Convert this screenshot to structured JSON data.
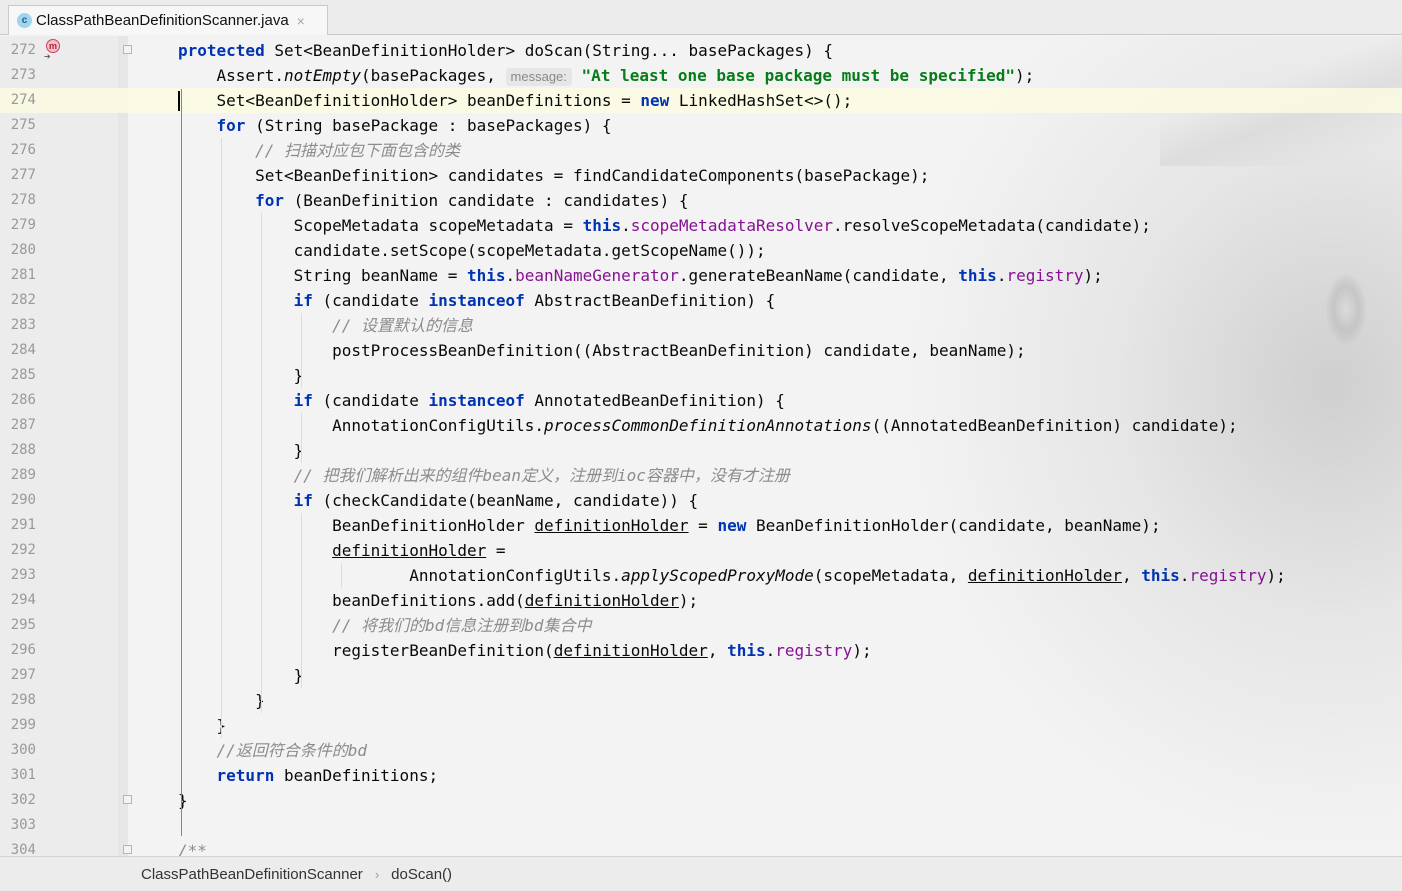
{
  "tab": {
    "icon_letter": "c",
    "title": "ClassPathBeanDefinitionScanner.java",
    "close": "×"
  },
  "gutter_icon": {
    "method_letter": "m"
  },
  "lines": [
    {
      "num": "272",
      "code": "<span class='kw'>protected</span> Set&lt;BeanDefinitionHolder&gt; doScan(String... basePackages) {"
    },
    {
      "num": "273",
      "code": "    Assert.<span class='it'>notEmpty</span>(basePackages, <span class='hint'>message:</span> <span class='str'>\"At least one base package must be specified\"</span>);"
    },
    {
      "num": "274",
      "code": "    Set&lt;BeanDefinitionHolder&gt; beanDefinitions = <span class='kw'>new</span> LinkedHashSet&lt;&gt;();"
    },
    {
      "num": "275",
      "code": "    <span class='kw'>for</span> (String basePackage : basePackages) {"
    },
    {
      "num": "276",
      "code": "        <span class='cmt'>// 扫描对应包下面包含的类</span>"
    },
    {
      "num": "277",
      "code": "        Set&lt;BeanDefinition&gt; candidates = findCandidateComponents(basePackage);"
    },
    {
      "num": "278",
      "code": "        <span class='kw'>for</span> (BeanDefinition candidate : candidates) {"
    },
    {
      "num": "279",
      "code": "            ScopeMetadata scopeMetadata = <span class='kw'>this</span>.<span class='fld'>scopeMetadataResolver</span>.resolveScopeMetadata(candidate);"
    },
    {
      "num": "280",
      "code": "            candidate.setScope(scopeMetadata.getScopeName());"
    },
    {
      "num": "281",
      "code": "            String beanName = <span class='kw'>this</span>.<span class='fld'>beanNameGenerator</span>.generateBeanName(candidate, <span class='kw'>this</span>.<span class='fld'>registry</span>);"
    },
    {
      "num": "282",
      "code": "            <span class='kw'>if</span> (candidate <span class='kw'>instanceof</span> AbstractBeanDefinition) {"
    },
    {
      "num": "283",
      "code": "                <span class='cmt'>// 设置默认的信息</span>"
    },
    {
      "num": "284",
      "code": "                postProcessBeanDefinition((AbstractBeanDefinition) candidate, beanName);"
    },
    {
      "num": "285",
      "code": "            }"
    },
    {
      "num": "286",
      "code": "            <span class='kw'>if</span> (candidate <span class='kw'>instanceof</span> AnnotatedBeanDefinition) {"
    },
    {
      "num": "287",
      "code": "                AnnotationConfigUtils.<span class='it'>processCommonDefinitionAnnotations</span>((AnnotatedBeanDefinition) candidate);"
    },
    {
      "num": "288",
      "code": "            }"
    },
    {
      "num": "289",
      "code": "            <span class='cmt'>// 把我们解析出来的组件bean定义，注册到ioc容器中，没有才注册</span>"
    },
    {
      "num": "290",
      "code": "            <span class='kw'>if</span> (checkCandidate(beanName, candidate)) {"
    },
    {
      "num": "291",
      "code": "                BeanDefinitionHolder <span class='u'>definitionHolder</span> = <span class='kw'>new</span> BeanDefinitionHolder(candidate, beanName);"
    },
    {
      "num": "292",
      "code": "                <span class='u'>definitionHolder</span> ="
    },
    {
      "num": "293",
      "code": "                        AnnotationConfigUtils.<span class='it'>applyScopedProxyMode</span>(scopeMetadata, <span class='u'>definitionHolder</span>, <span class='kw'>this</span>.<span class='fld'>registry</span>);"
    },
    {
      "num": "294",
      "code": "                beanDefinitions.add(<span class='u'>definitionHolder</span>);"
    },
    {
      "num": "295",
      "code": "                <span class='cmt'>// 将我们的bd信息注册到bd集合中</span>"
    },
    {
      "num": "296",
      "code": "                registerBeanDefinition(<span class='u'>definitionHolder</span>, <span class='kw'>this</span>.<span class='fld'>registry</span>);"
    },
    {
      "num": "297",
      "code": "            }"
    },
    {
      "num": "298",
      "code": "        }"
    },
    {
      "num": "299",
      "code": "    }"
    },
    {
      "num": "300",
      "code": "    <span class='cmt'>//返回符合条件的bd</span>"
    },
    {
      "num": "301",
      "code": "    <span class='kw'>return</span> beanDefinitions;"
    },
    {
      "num": "302",
      "code": "}"
    },
    {
      "num": "303",
      "code": ""
    },
    {
      "num": "304",
      "code": "<span class='cmt'>/**</span>"
    }
  ],
  "current_line": "274",
  "breadcrumb": {
    "class_name": "ClassPathBeanDefinitionScanner",
    "separator": "›",
    "method_name": "doScan()"
  }
}
